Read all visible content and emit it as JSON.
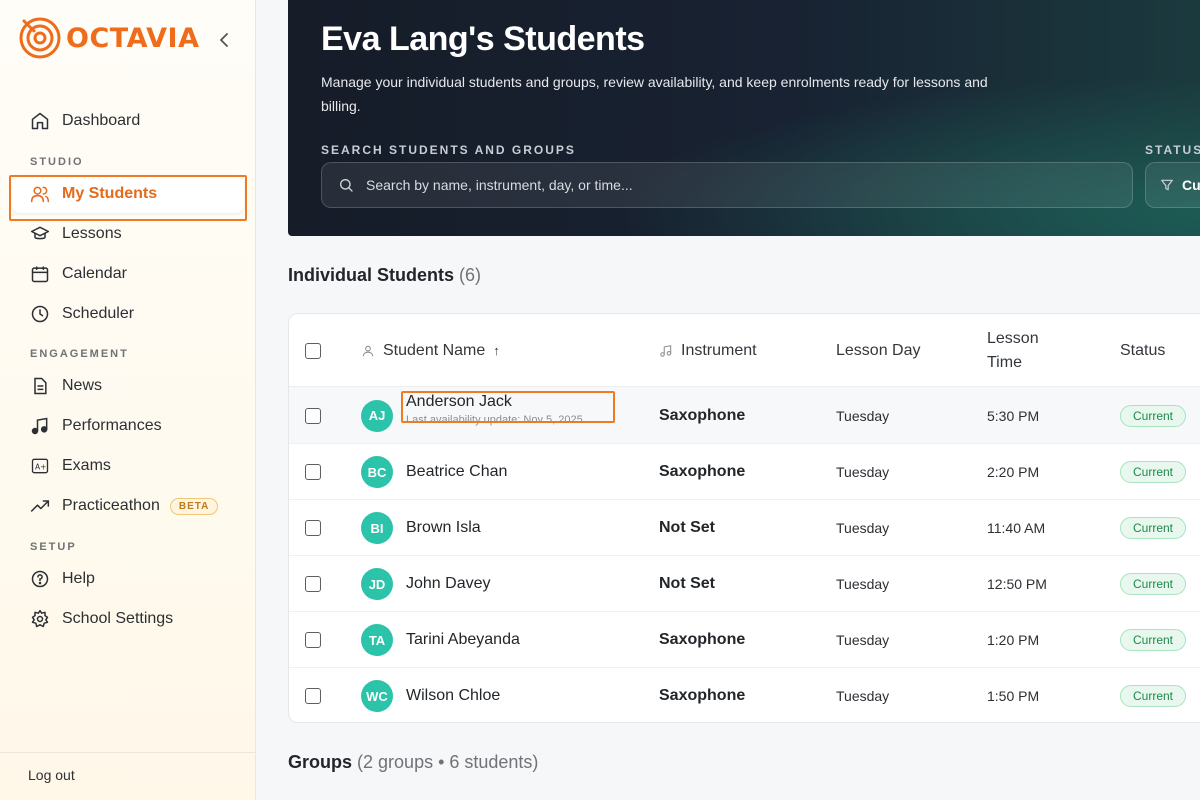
{
  "sidebar": {
    "logo_text": "OCTAVIA",
    "items": [
      {
        "label": "Dashboard"
      },
      {
        "label": "My Students"
      },
      {
        "label": "Lessons"
      },
      {
        "label": "Calendar"
      },
      {
        "label": "Scheduler"
      },
      {
        "label": "News"
      },
      {
        "label": "Performances"
      },
      {
        "label": "Exams"
      },
      {
        "label": "Practiceathon",
        "badge": "BETA"
      },
      {
        "label": "Help"
      },
      {
        "label": "School Settings"
      }
    ],
    "sections": {
      "studio": "STUDIO",
      "engagement": "ENGAGEMENT",
      "setup": "SETUP"
    },
    "logout": "Log out"
  },
  "hero": {
    "title": "Eva Lang's Students",
    "description": "Manage your individual students and groups, review availability, and keep enrolments ready for lessons and billing.",
    "search_label": "SEARCH STUDENTS AND GROUPS",
    "search_placeholder": "Search by name, instrument, day, or time...",
    "status_label": "STATUS",
    "status_value": "Cu"
  },
  "individual": {
    "title": "Individual Students",
    "count": "(6)"
  },
  "table": {
    "headers": {
      "name": "Student Name",
      "sort": "↑",
      "instrument": "Instrument",
      "day": "Lesson Day",
      "time_line1": "Lesson",
      "time_line2": "Time",
      "status": "Status"
    },
    "rows": [
      {
        "initials": "AJ",
        "name": "Anderson Jack",
        "sub": "Last availability update: Nov 5, 2025",
        "instrument": "Saxophone",
        "day": "Tuesday",
        "time": "5:30 PM",
        "status": "Current"
      },
      {
        "initials": "BC",
        "name": "Beatrice Chan",
        "sub": "",
        "instrument": "Saxophone",
        "day": "Tuesday",
        "time": "2:20 PM",
        "status": "Current"
      },
      {
        "initials": "BI",
        "name": "Brown Isla",
        "sub": "",
        "instrument": "Not Set",
        "day": "Tuesday",
        "time": "11:40 AM",
        "status": "Current"
      },
      {
        "initials": "JD",
        "name": "John Davey",
        "sub": "",
        "instrument": "Not Set",
        "day": "Tuesday",
        "time": "12:50 PM",
        "status": "Current"
      },
      {
        "initials": "TA",
        "name": "Tarini Abeyanda",
        "sub": "",
        "instrument": "Saxophone",
        "day": "Tuesday",
        "time": "1:20 PM",
        "status": "Current"
      },
      {
        "initials": "WC",
        "name": "Wilson Chloe",
        "sub": "",
        "instrument": "Saxophone",
        "day": "Tuesday",
        "time": "1:50 PM",
        "status": "Current"
      }
    ]
  },
  "groups": {
    "title": "Groups",
    "count": "(2 groups • 6 students)"
  },
  "colors": {
    "accent": "#ef6c1b",
    "avatar": "#2bc3a9",
    "status_green": "#1d8a4a"
  }
}
